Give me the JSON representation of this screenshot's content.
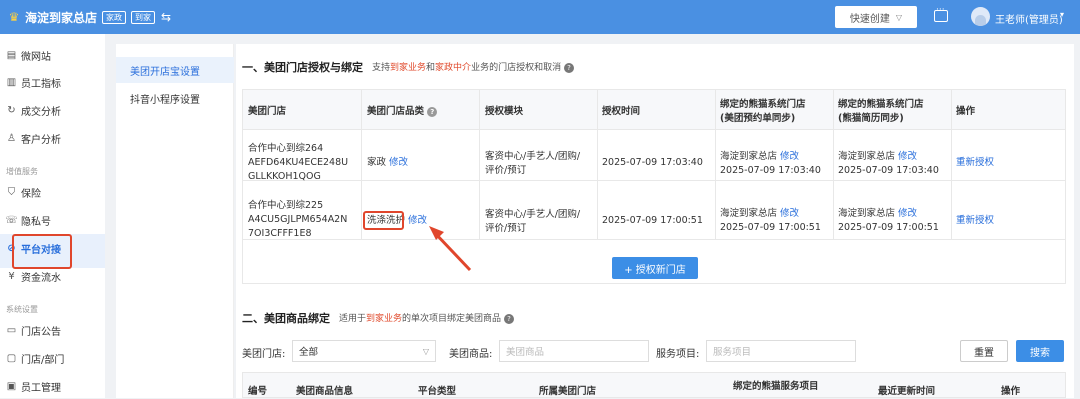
{
  "header": {
    "shop_title": "海淀到家总店",
    "tags": [
      "家政",
      "到家"
    ],
    "quick_create": "快速创建",
    "user_name": "王老师(管理员)"
  },
  "sidebar": {
    "items_top": [
      {
        "label": "微网站",
        "icon": "page-icon"
      },
      {
        "label": "员工指标",
        "icon": "doc-icon"
      },
      {
        "label": "成交分析",
        "icon": "refresh-icon"
      },
      {
        "label": "客户分析",
        "icon": "user-icon"
      }
    ],
    "section_value": "增值服务",
    "items_value": [
      {
        "label": "保险",
        "icon": "shield-icon"
      },
      {
        "label": "隐私号",
        "icon": "phone-icon"
      },
      {
        "label": "平台对接",
        "icon": "link-icon"
      },
      {
        "label": "资金流水",
        "icon": "money-icon"
      }
    ],
    "section_system": "系统设置",
    "items_system": [
      {
        "label": "门店公告",
        "icon": "board-icon"
      },
      {
        "label": "门店/部门",
        "icon": "folder-icon"
      },
      {
        "label": "员工管理",
        "icon": "staff-icon"
      }
    ]
  },
  "subnav": {
    "items": [
      "美团开店宝设置",
      "抖音小程序设置"
    ]
  },
  "section1": {
    "title": "一、美团门店授权与绑定",
    "note_prefix": "支持",
    "note_hl1": "到家业务",
    "note_mid": "和",
    "note_hl2": "家政中介",
    "note_suffix": "业务的门店授权和取消",
    "columns": [
      "美团门店",
      "美团门店品类",
      "授权模块",
      "授权时间",
      "绑定的熊猫系统门店\n(美团预约单同步)",
      "绑定的熊猫系统门店\n(熊猫简历同步)",
      "操作"
    ],
    "rows": [
      {
        "store": "合作中心到综264\nAEFD64KU4ECE248U\nGLLKKOH1QOG",
        "category": "家政",
        "edit": "修改",
        "modules": "客资中心/手艺人/团购/\n评价/预订",
        "auth_time": "2025-07-09 17:03:40",
        "bind1_store": "海淀到家总店",
        "bind1_time": "2025-07-09 17:03:40",
        "bind2_store": "海淀到家总店",
        "bind2_time": "2025-07-09 17:03:40",
        "action": "重新授权"
      },
      {
        "store": "合作中心到综225\nA4CU5GJLPM654A2N\n7OI3CFFF1E8",
        "category": "洗涤洗护",
        "edit": "修改",
        "modules": "客资中心/手艺人/团购/\n评价/预订",
        "auth_time": "2025-07-09 17:00:51",
        "bind1_store": "海淀到家总店",
        "bind1_time": "2025-07-09 17:00:51",
        "bind2_store": "海淀到家总店",
        "bind2_time": "2025-07-09 17:00:51",
        "action": "重新授权"
      }
    ],
    "add_button": "+ 授权新门店"
  },
  "section2": {
    "title": "二、美团商品绑定",
    "note_prefix": "适用于",
    "note_hl": "到家业务",
    "note_suffix": "的单次项目绑定美团商品",
    "filter_store_label": "美团门店:",
    "filter_store_value": "全部",
    "filter_goods_label": "美团商品:",
    "filter_goods_placeholder": "美团商品",
    "filter_service_label": "服务项目:",
    "filter_service_placeholder": "服务项目",
    "reset": "重置",
    "search": "搜索",
    "columns": [
      "编号",
      "美团商品信息",
      "平台类型",
      "所属美团门店",
      "绑定的熊猫服务项目",
      "最近更新时间",
      "操作"
    ]
  },
  "colors": {
    "header_bg": "#4a90e2",
    "accent": "#2a6fdb",
    "highlight": "#e04a2c"
  }
}
